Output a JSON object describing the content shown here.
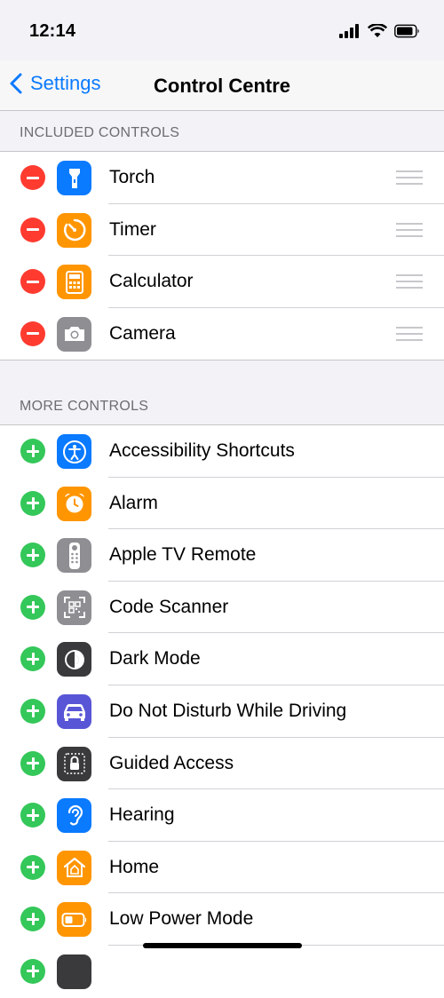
{
  "status": {
    "time": "12:14"
  },
  "nav": {
    "back_label": "Settings",
    "title": "Control Centre"
  },
  "colors": {
    "accent": "#0a7aff",
    "remove": "#ff3b30",
    "add": "#34c759",
    "blue": "#0a7aff",
    "orange": "#ff9500",
    "gray": "#8e8e93",
    "dark": "#3a3a3c",
    "purple": "#5856d6"
  },
  "included": {
    "header": "INCLUDED CONTROLS",
    "items": [
      {
        "label": "Torch",
        "icon": "torch-icon",
        "color": "#0a7aff"
      },
      {
        "label": "Timer",
        "icon": "timer-icon",
        "color": "#ff9500"
      },
      {
        "label": "Calculator",
        "icon": "calculator-icon",
        "color": "#ff9500"
      },
      {
        "label": "Camera",
        "icon": "camera-icon",
        "color": "#8e8e93"
      }
    ]
  },
  "more": {
    "header": "MORE CONTROLS",
    "items": [
      {
        "label": "Accessibility Shortcuts",
        "icon": "accessibility-icon",
        "color": "#0a7aff"
      },
      {
        "label": "Alarm",
        "icon": "alarm-icon",
        "color": "#ff9500"
      },
      {
        "label": "Apple TV Remote",
        "icon": "tv-remote-icon",
        "color": "#8e8e93"
      },
      {
        "label": "Code Scanner",
        "icon": "qr-code-icon",
        "color": "#8e8e93"
      },
      {
        "label": "Dark Mode",
        "icon": "dark-mode-icon",
        "color": "#3a3a3c"
      },
      {
        "label": "Do Not Disturb While Driving",
        "icon": "car-icon",
        "color": "#5856d6"
      },
      {
        "label": "Guided Access",
        "icon": "lock-icon",
        "color": "#3a3a3c"
      },
      {
        "label": "Hearing",
        "icon": "ear-icon",
        "color": "#0a7aff"
      },
      {
        "label": "Home",
        "icon": "home-icon",
        "color": "#ff9500"
      },
      {
        "label": "Low Power Mode",
        "icon": "battery-icon",
        "color": "#ff9500"
      }
    ]
  }
}
